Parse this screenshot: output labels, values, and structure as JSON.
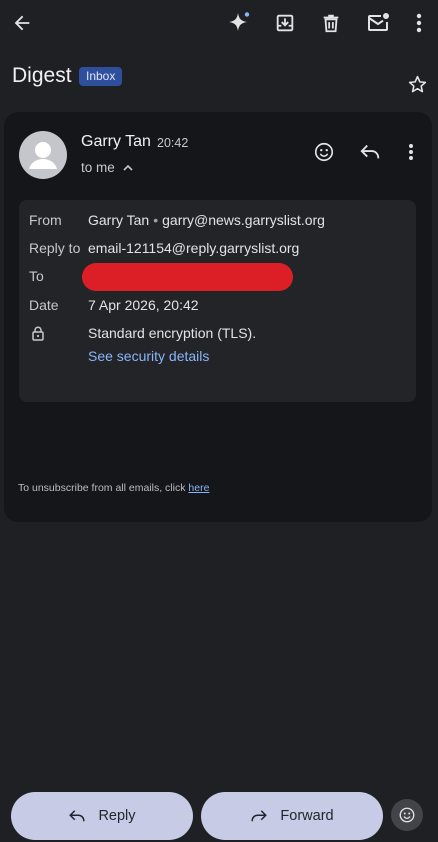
{
  "toolbar": {
    "back_icon": "arrow-back-icon",
    "sparkle_icon": "gemini-sparkle-icon",
    "archive_icon": "archive-icon",
    "delete_icon": "trash-icon",
    "mark_unread_icon": "mark-unread-icon",
    "more_icon": "more-vert-icon"
  },
  "subject": {
    "text": "Digest",
    "label": "Inbox",
    "star_icon": "star-outline-icon"
  },
  "message": {
    "sender_name": "Garry Tan",
    "time": "20:42",
    "recipient_summary": "to me",
    "details": {
      "from_label": "From",
      "from_name": "Garry Tan",
      "from_separator": "•",
      "from_email": "garry@news.garryslist.org",
      "reply_to_label": "Reply to",
      "reply_to_value": "email-121154@reply.garryslist.org",
      "to_label": "To",
      "date_label": "Date",
      "date_value": "7 Apr 2026, 20:42",
      "encryption_text": "Standard encryption (TLS).",
      "security_link": "See security details"
    },
    "unsubscribe_text": "To unsubscribe from all emails, click ",
    "unsubscribe_link": "here"
  },
  "bottom": {
    "reply_label": "Reply",
    "forward_label": "Forward"
  },
  "colors": {
    "background": "#1f2024",
    "card": "#15161a",
    "details_panel": "#232428",
    "label_chip": "#2f4e9b",
    "link": "#8ab4f8",
    "pill": "#c7cbe6",
    "redaction": "#dc1f26"
  }
}
